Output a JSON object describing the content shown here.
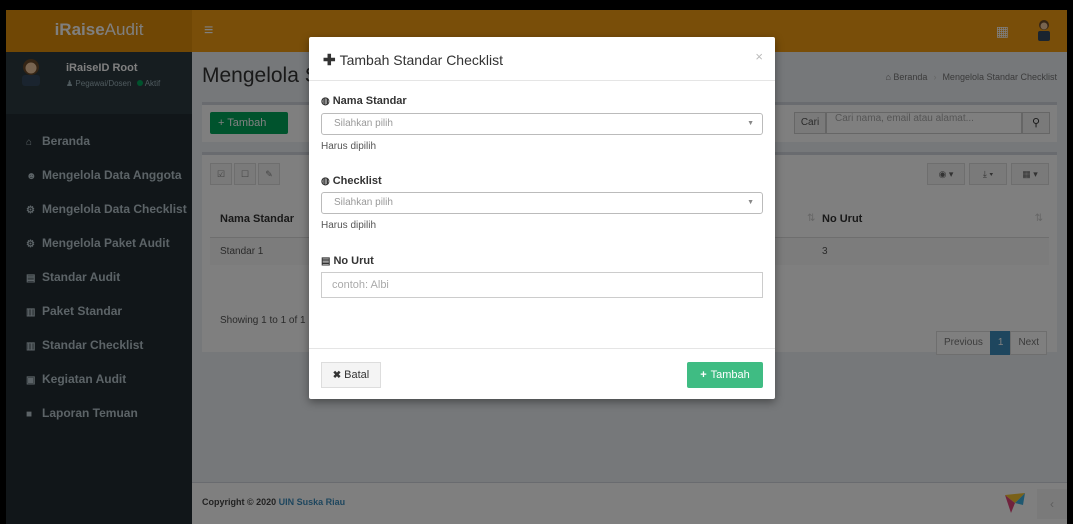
{
  "app": {
    "logo_bold": "iRaise",
    "logo_rest": "Audit"
  },
  "topbar": {
    "menu_icon": "hamburger-icon",
    "grid_icon": "grid-icon",
    "user_icon": "user-icon"
  },
  "sidebar": {
    "user_name": "iRaiseID Root",
    "user_role": "Pegawai/Dosen",
    "user_status": "Aktif",
    "items": [
      {
        "label": "Beranda",
        "icon": "home-icon"
      },
      {
        "label": "Mengelola Data Anggota",
        "icon": "users-icon"
      },
      {
        "label": "Mengelola Data Checklist",
        "icon": "cogs-icon"
      },
      {
        "label": "Mengelola Paket Audit",
        "icon": "cogs-icon"
      },
      {
        "label": "Standar Audit",
        "icon": "book-icon"
      },
      {
        "label": "Paket Standar",
        "icon": "bar-chart-icon"
      },
      {
        "label": "Standar Checklist",
        "icon": "bar-chart-icon"
      },
      {
        "label": "Kegiatan Audit",
        "icon": "list-alt-icon"
      },
      {
        "label": "Laporan Temuan",
        "icon": "folder-icon"
      }
    ]
  },
  "content": {
    "title": "Mengelola St",
    "breadcrumb_home": "Beranda",
    "breadcrumb_current": "Mengelola Standar Checklist",
    "add_button": "Tambah",
    "search_label": "Cari",
    "search_placeholder": "Cari nama, email atau alamat...",
    "table": {
      "col_left": "Nama Standar",
      "col_right": "No Urut",
      "rows": [
        {
          "nama": "Standar 1",
          "urut": "3"
        }
      ]
    },
    "showing": "Showing 1 to 1 of 1",
    "pager": {
      "prev": "Previous",
      "page": "1",
      "next": "Next"
    }
  },
  "footer": {
    "copyright": "Copyright © 2020 ",
    "org": "UIN Suska Riau"
  },
  "modal": {
    "title": "Tambah Standar Checklist",
    "close": "×",
    "field1_label": "Nama Standar",
    "field1_placeholder": "Silahkan pilih",
    "field1_help": "Harus dipilih",
    "field2_label": "Checklist",
    "field2_placeholder": "Silahkan pilih",
    "field2_help": "Harus dipilih",
    "field3_label": "No Urut",
    "field3_placeholder": "contoh: Albi",
    "cancel_label": "Batal",
    "submit_label": "Tambah"
  },
  "colors": {
    "topbar": "#f39c12",
    "sidebar": "#222d32",
    "accent_green": "#00a65a",
    "link_blue": "#3c8dbc"
  }
}
